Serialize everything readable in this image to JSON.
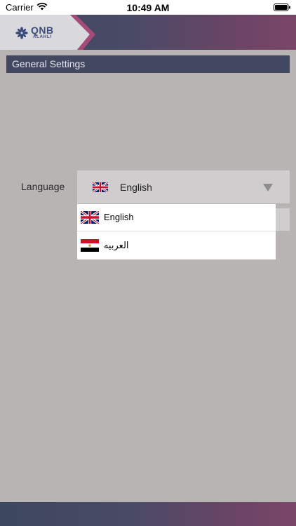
{
  "status_bar": {
    "carrier": "Carrier",
    "time": "10:49 AM",
    "wifi_icon": "wifi-icon",
    "battery_icon": "battery-icon"
  },
  "header": {
    "logo": {
      "brand": "QNB",
      "sub": "ALAHLI"
    }
  },
  "settings": {
    "title": "General Settings",
    "language": {
      "label": "Language",
      "selected": "English",
      "selected_flag": "uk-flag-icon",
      "options": [
        {
          "label": "English",
          "flag": "uk-flag-icon"
        },
        {
          "label": "العربيه",
          "flag": "egypt-flag-icon"
        }
      ]
    }
  },
  "colors": {
    "header_start": "#3d4760",
    "header_end": "#7a4668",
    "overlay_background": "#b8b4b4",
    "section_title_bg": "#414860"
  }
}
